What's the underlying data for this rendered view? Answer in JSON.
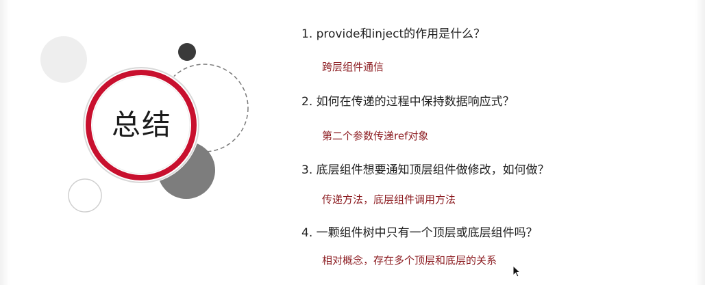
{
  "title": "总结",
  "items": [
    {
      "question": "1. provide和inject的作用是什么？",
      "answer": "跨层组件通信"
    },
    {
      "question": "2. 如何在传递的过程中保持数据响应式？",
      "answer": "第二个参数传递ref对象"
    },
    {
      "question": "3.  底层组件想要通知顶层组件做修改，如何做？",
      "answer": "传递方法，底层组件调用方法"
    },
    {
      "question": "4. 一颗组件树中只有一个顶层或底层组件吗？",
      "answer": "相对概念，存在多个顶层和底层的关系"
    }
  ],
  "colors": {
    "accent_red": "#c8102e",
    "answer_red": "#8b1a1f"
  }
}
